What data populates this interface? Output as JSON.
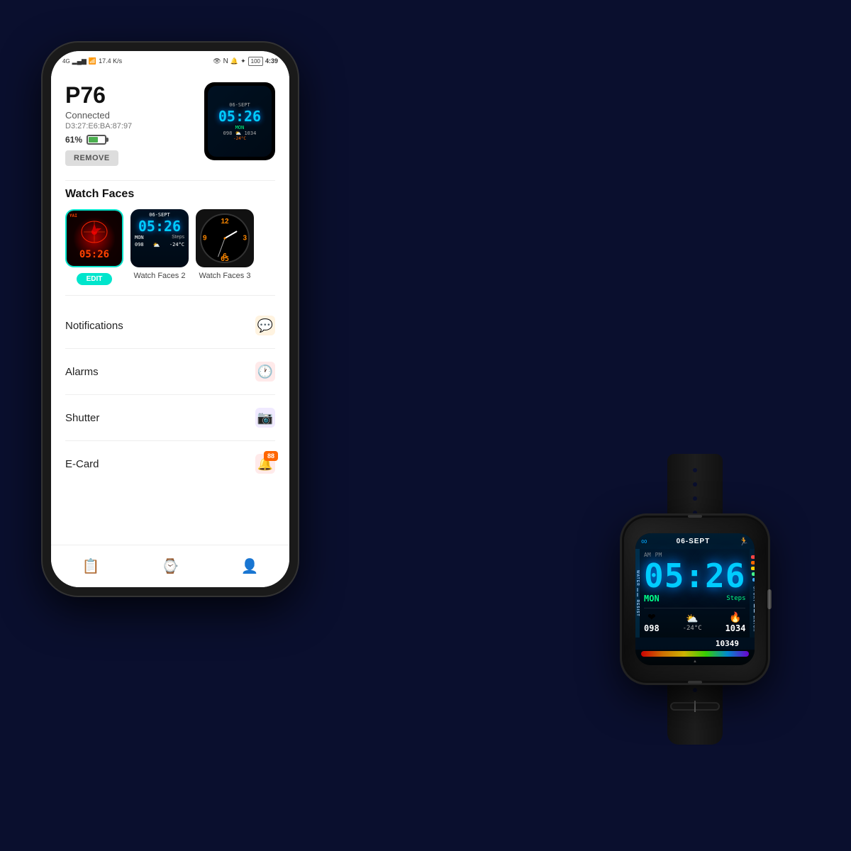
{
  "background": {
    "color": "#0a0f2e"
  },
  "phone": {
    "status_bar": {
      "network": "4G",
      "signal": "●●●",
      "wifi": "▲",
      "speed": "17.4 K/s",
      "time": "4:39",
      "battery": "100"
    },
    "device": {
      "name": "P76",
      "status": "Connected",
      "mac": "D3:27:E6:BA:87:97",
      "battery_pct": "61%"
    },
    "remove_label": "REMOVE",
    "watch_faces_title": "Watch Faces",
    "watch_faces": [
      {
        "label": "",
        "edit": "EDIT"
      },
      {
        "label": "Watch Faces 2"
      },
      {
        "label": "Watch Faces 3"
      }
    ],
    "menu_items": [
      {
        "label": "Notifications",
        "icon": "💬",
        "icon_color": "#ff8800"
      },
      {
        "label": "Alarms",
        "icon": "🕐",
        "icon_color": "#ff3333"
      },
      {
        "label": "Shutter",
        "icon": "📷",
        "icon_color": "#9966ff"
      },
      {
        "label": "E-Card",
        "icon": "🔔",
        "icon_color": "#ff3333"
      }
    ],
    "bottom_nav": [
      {
        "icon": "📋",
        "active": false
      },
      {
        "icon": "⌚",
        "active": true
      },
      {
        "icon": "👤",
        "active": false
      }
    ]
  },
  "smartwatch": {
    "date": "06-SEPT",
    "time": "05:26",
    "ampm": [
      "AM",
      "PM"
    ],
    "steps": "10349",
    "steps_label": "Steps",
    "day": "MON",
    "heart_rate": "098",
    "weather_icon": "⛅",
    "energy": "1034",
    "temperature": "-24°C"
  }
}
